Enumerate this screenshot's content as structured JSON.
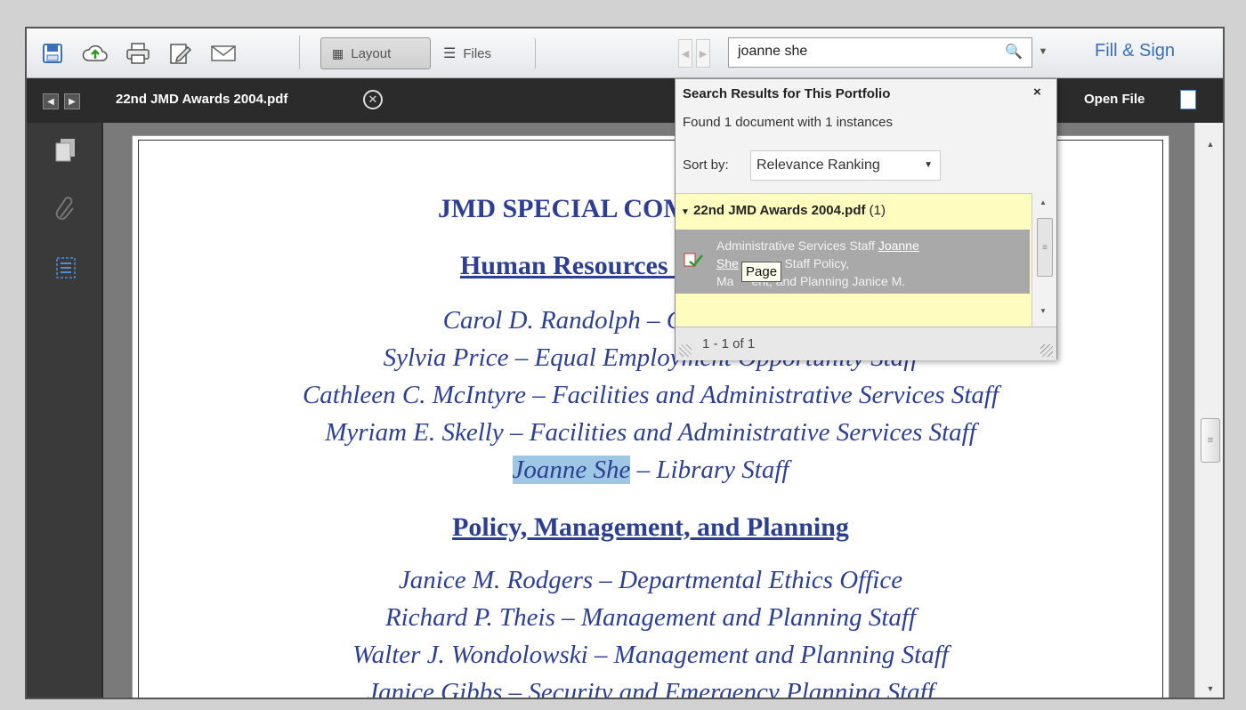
{
  "toolbar": {
    "icons": [
      "save-icon",
      "cloud-upload-icon",
      "print-icon",
      "edit-icon",
      "email-icon"
    ],
    "layout_label": "Layout",
    "files_label": "Files",
    "search_value": "joanne she",
    "fill_sign_label": "Fill & Sign"
  },
  "docbar": {
    "filename": "22nd JMD Awards 2004.pdf",
    "open_file_label": "Open File"
  },
  "document": {
    "lines": [
      {
        "text": "JMD SPECIAL COMM"
      },
      {
        "text": "Human Resources a"
      },
      {
        "text": "Carol D. Randolph – Cons"
      },
      {
        "text": "Sylvia Price – Equal Employment Opportunity Staff"
      },
      {
        "text": "Cathleen C. McIntyre – Facilities and Administrative Services Staff"
      },
      {
        "text": "Myriam E. Skelly – Facilities and Administrative Services Staff"
      },
      {
        "highlight": "Joanne She",
        "rest": " – Library Staff"
      },
      {
        "text": "Policy, Management, and Planning"
      },
      {
        "text": "Janice M. Rodgers – Departmental Ethics Office"
      },
      {
        "text": "Richard P. Theis – Management and Planning Staff"
      },
      {
        "text": "Walter J. Wondolowski – Management and Planning Staff"
      },
      {
        "text": "Janice Gibbs – Security and Emergency Planning Staff"
      }
    ]
  },
  "search_panel": {
    "title": "Search Results for This Portfolio",
    "close": "×",
    "found": "Found 1 document with 1 instances",
    "sort_label": "Sort by:",
    "sort_value": "Relevance Ranking",
    "result_file": "22nd JMD Awards 2004.pdf",
    "result_count": "(1)",
    "result_line1_pre": "Administrative Services Staff ",
    "result_line1_link": "Joanne",
    "result_line2_link": "She",
    "result_line2_rest": "ry Staff Policy,",
    "result_line3_pre": "Ma",
    "result_line3_rest": "ent, and Planning Janice M.",
    "tooltip": "Page",
    "footer": "1 - 1 of 1"
  }
}
